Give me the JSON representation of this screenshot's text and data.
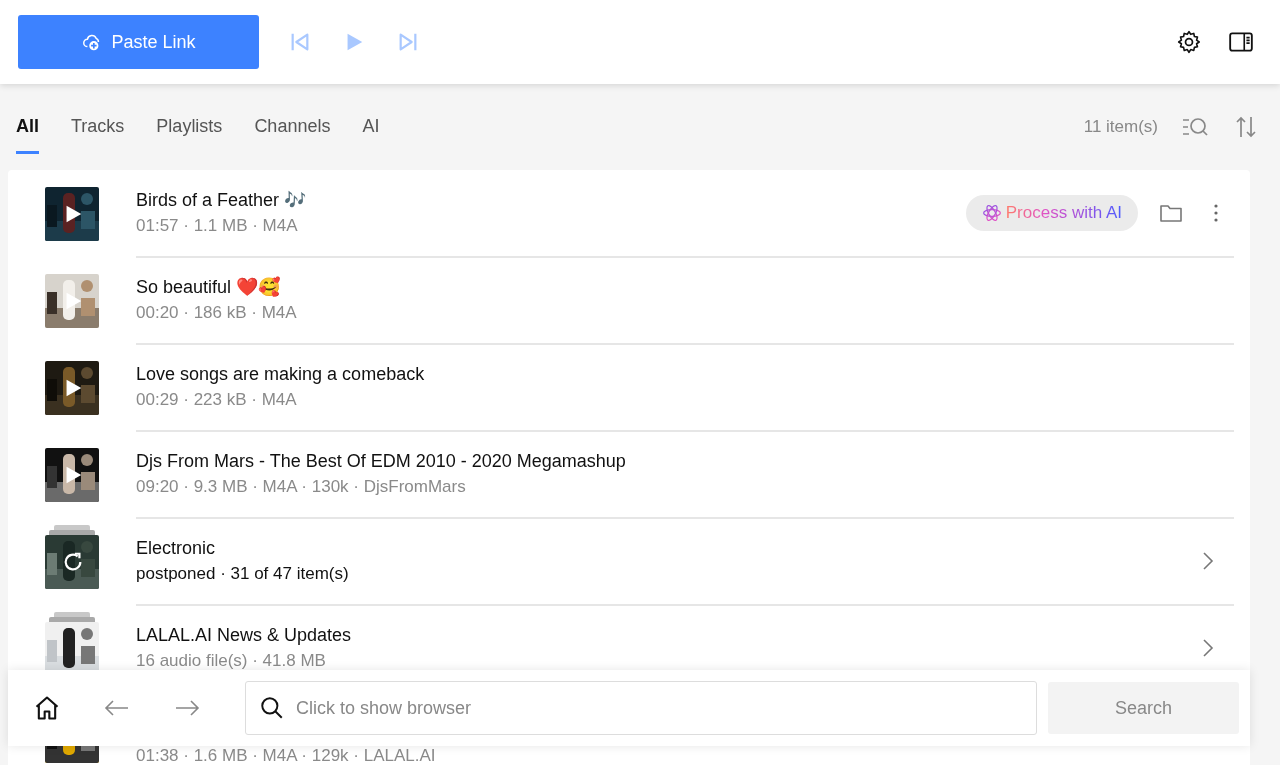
{
  "toolbar": {
    "paste_button": "Paste Link",
    "player_disabled": true
  },
  "tabs": [
    {
      "label": "All",
      "selected": true
    },
    {
      "label": "Tracks",
      "selected": false
    },
    {
      "label": "Playlists",
      "selected": false
    },
    {
      "label": "Channels",
      "selected": false
    },
    {
      "label": "AI",
      "selected": false
    }
  ],
  "item_count": "11 item(s)",
  "rows": [
    {
      "kind": "track",
      "title": "Birds of a Feather 🎶",
      "meta": "01:57 · 1.1 MB · M4A",
      "hovered": true,
      "ai_button": "Process with AI"
    },
    {
      "kind": "track",
      "title": "So beautiful ❤️🥰",
      "meta": "00:20 · 186 kB · M4A",
      "hovered": false
    },
    {
      "kind": "track",
      "title": "Love songs are making a comeback",
      "meta": "00:29 · 223 kB · M4A",
      "hovered": false
    },
    {
      "kind": "track",
      "title": "Djs From Mars - The Best Of EDM 2010 - 2020 Megamashup",
      "meta": "09:20 · 9.3 MB · M4A · 130k · DjsFromMars",
      "hovered": false
    },
    {
      "kind": "playlist",
      "title": "Electronic",
      "meta": "postponed · 31 of 47 item(s)",
      "postponed": true
    },
    {
      "kind": "playlist",
      "title": "LALAL.AI News & Updates",
      "meta": "16 audio file(s) · 41.8 MB",
      "postponed": false
    },
    {
      "kind": "track",
      "meta": "01:38 · 1.6 MB · M4A · 129k · LALAL.AI",
      "hovered": false
    }
  ],
  "bottom_bar": {
    "placeholder": "Click to show browser",
    "search_button": "Search",
    "search_disabled": true
  }
}
